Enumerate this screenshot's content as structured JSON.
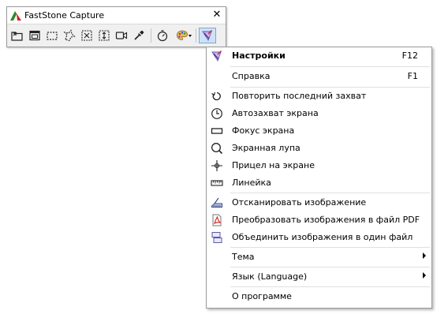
{
  "window": {
    "title": "FastStone Capture",
    "close_glyph": "✕"
  },
  "toolbar": {
    "buttons": [
      {
        "icon": "open-folder-icon"
      },
      {
        "icon": "capture-window-icon"
      },
      {
        "icon": "capture-rectangle-icon"
      },
      {
        "icon": "capture-freehand-icon"
      },
      {
        "icon": "capture-fullscreen-icon"
      },
      {
        "icon": "capture-scrolling-icon"
      },
      {
        "icon": "screen-recorder-icon"
      },
      {
        "icon": "color-picker-icon"
      },
      {
        "icon": "delay-timer-icon"
      },
      {
        "icon": "output-palette-icon"
      },
      {
        "icon": "settings-menu-icon",
        "active": true
      }
    ]
  },
  "menu": {
    "items": [
      {
        "label": "Настройки",
        "shortcut": "F12",
        "icon": "settings-icon",
        "bold": true
      },
      {
        "label": "Справка",
        "shortcut": "F1"
      },
      {
        "label": "Повторить последний захват",
        "icon": "repeat-capture-icon"
      },
      {
        "label": "Автозахват экрана",
        "icon": "auto-capture-clock-icon"
      },
      {
        "label": "Фокус экрана",
        "icon": "screen-focus-icon"
      },
      {
        "label": "Экранная лупа",
        "icon": "magnifier-icon"
      },
      {
        "label": "Прицел на экране",
        "icon": "crosshair-icon"
      },
      {
        "label": "Линейка",
        "icon": "ruler-icon"
      },
      {
        "label": "Отсканировать изображение",
        "icon": "scanner-icon"
      },
      {
        "label": "Преобразовать изображения в файл PDF",
        "icon": "pdf-icon"
      },
      {
        "label": "Объединить изображения в один файл",
        "icon": "join-images-icon"
      },
      {
        "label": "Тема",
        "submenu": true
      },
      {
        "label": "Язык (Language)",
        "submenu": true
      },
      {
        "label": "О программе"
      }
    ]
  },
  "colors": {
    "logo_green": "#2a8a2a",
    "logo_red": "#d42020",
    "active_button": "#cde2f7"
  }
}
